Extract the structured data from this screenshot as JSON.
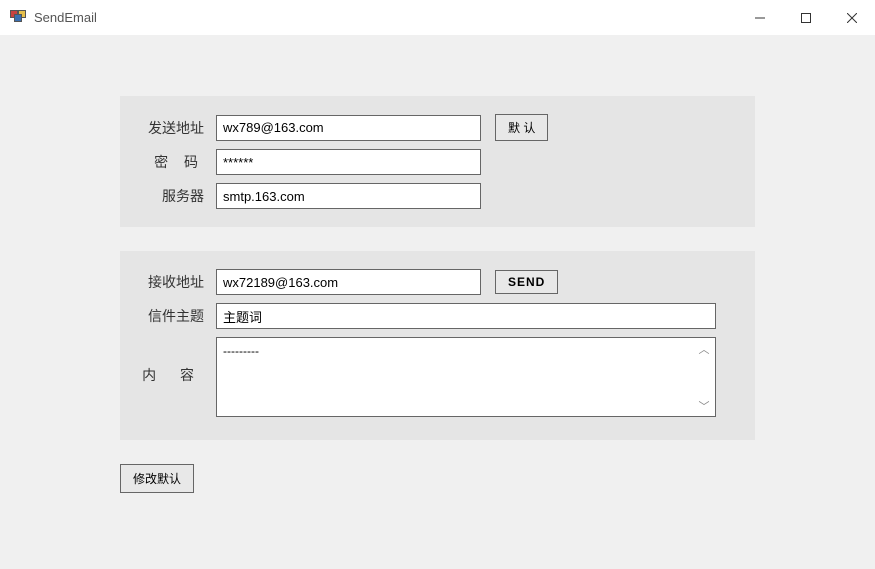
{
  "window": {
    "title": "SendEmail"
  },
  "sender": {
    "address_label": "发送地址",
    "address_value": "wx789@163.com",
    "password_label": "密 码",
    "password_value": "******",
    "server_label": "服务器",
    "server_value": "smtp.163.com",
    "default_button": "默 认"
  },
  "recipient": {
    "address_label": "接收地址",
    "address_value": "wx72189@163.com",
    "subject_label": "信件主题",
    "subject_value": "主题词",
    "content_label": "内 容",
    "content_value": "---------",
    "send_button": "SEND"
  },
  "footer": {
    "modify_default_button": "修改默认"
  }
}
